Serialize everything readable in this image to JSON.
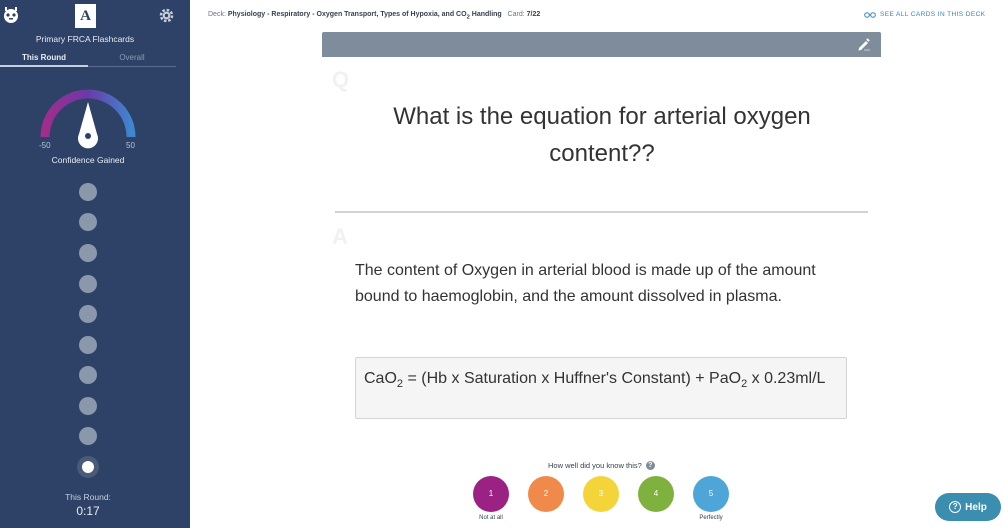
{
  "sidebar": {
    "logo_letter": "A",
    "deck_name": "Primary FRCA Flashcards",
    "tabs": [
      "This Round",
      "Overall"
    ],
    "gauge": {
      "min_label": "-50",
      "max_label": "50",
      "label": "Confidence Gained"
    },
    "card_progress_count": 10,
    "round_label": "This Round:",
    "timer": "0:17"
  },
  "header": {
    "deck_prefix": "Deck:",
    "deck_title_a": "Physiology - Respiratory - Oxygen Transport, Types of Hypoxia, and CO",
    "deck_title_sub": "2",
    "deck_title_b": " Handling",
    "card_label": "Card:",
    "card_position": "7/22",
    "see_all": "SEE ALL CARDS IN THIS DECK"
  },
  "card": {
    "q_letter": "Q",
    "question": "What is the equation for arterial oxygen content??",
    "a_letter": "A",
    "answer": "The content of Oxygen in arterial blood is made up of the amount bound to haemoglobin, and the amount dissolved in plasma.",
    "formula_part1": "CaO",
    "formula_sub1": "2",
    "formula_part2": " = (Hb x Saturation x Huffner's Constant) + PaO",
    "formula_sub2": "2",
    "formula_part3": " x 0.23ml/L"
  },
  "rating": {
    "prompt": "How well did you know this?",
    "buttons": [
      "1",
      "2",
      "3",
      "4",
      "5"
    ],
    "colors": [
      "#9b2282",
      "#ef8a4a",
      "#f3d53a",
      "#7fb13f",
      "#4ea6d8"
    ],
    "low_caption": "Not at all",
    "high_caption": "Perfectly"
  },
  "help": {
    "label": "Help"
  }
}
